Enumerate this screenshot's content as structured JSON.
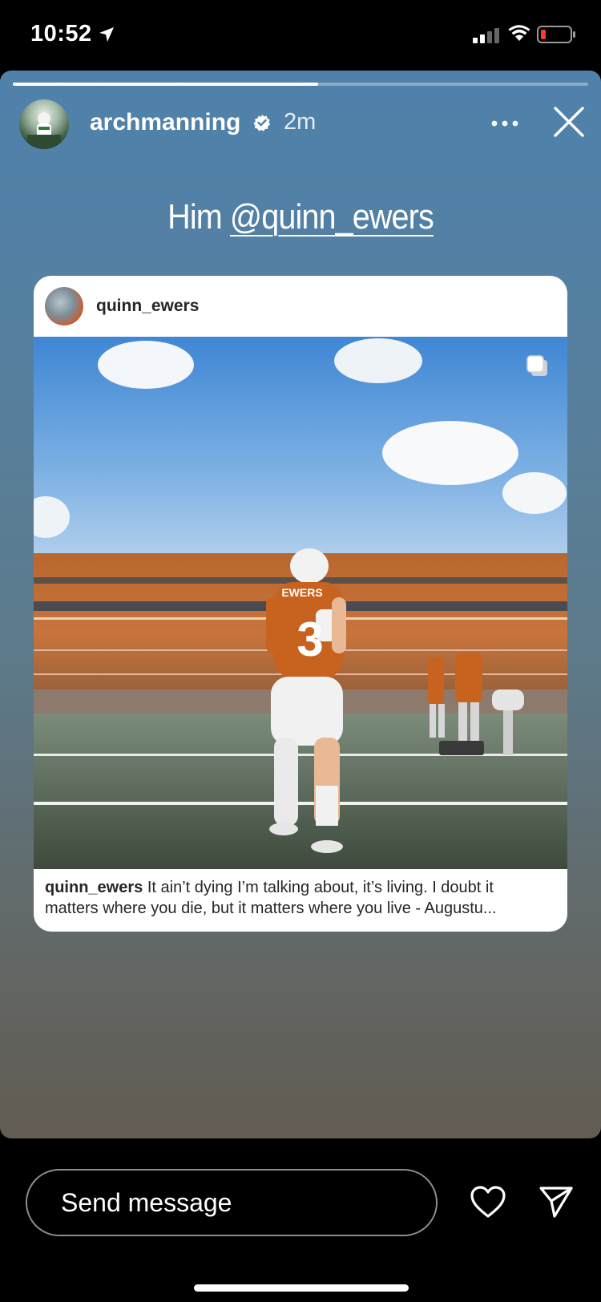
{
  "status_bar": {
    "time": "10:52"
  },
  "story": {
    "progress": 0.53,
    "username": "archmanning",
    "time_ago": "2m",
    "caption_prefix": "Him",
    "mention": "@quinn_ewers"
  },
  "post": {
    "username": "quinn_ewers",
    "caption_user": "quinn_ewers",
    "caption_line1": "It ain’t dying I’m talking about, it’s living. I doubt it",
    "caption_line2": "matters where you die, but it matters where you live - Augustu...",
    "jersey_name": "EWERS",
    "jersey_number": "3"
  },
  "composer": {
    "placeholder": "Send message"
  },
  "colors": {
    "accent_orange": "#c8631f",
    "sky": "#4f8fd6"
  }
}
